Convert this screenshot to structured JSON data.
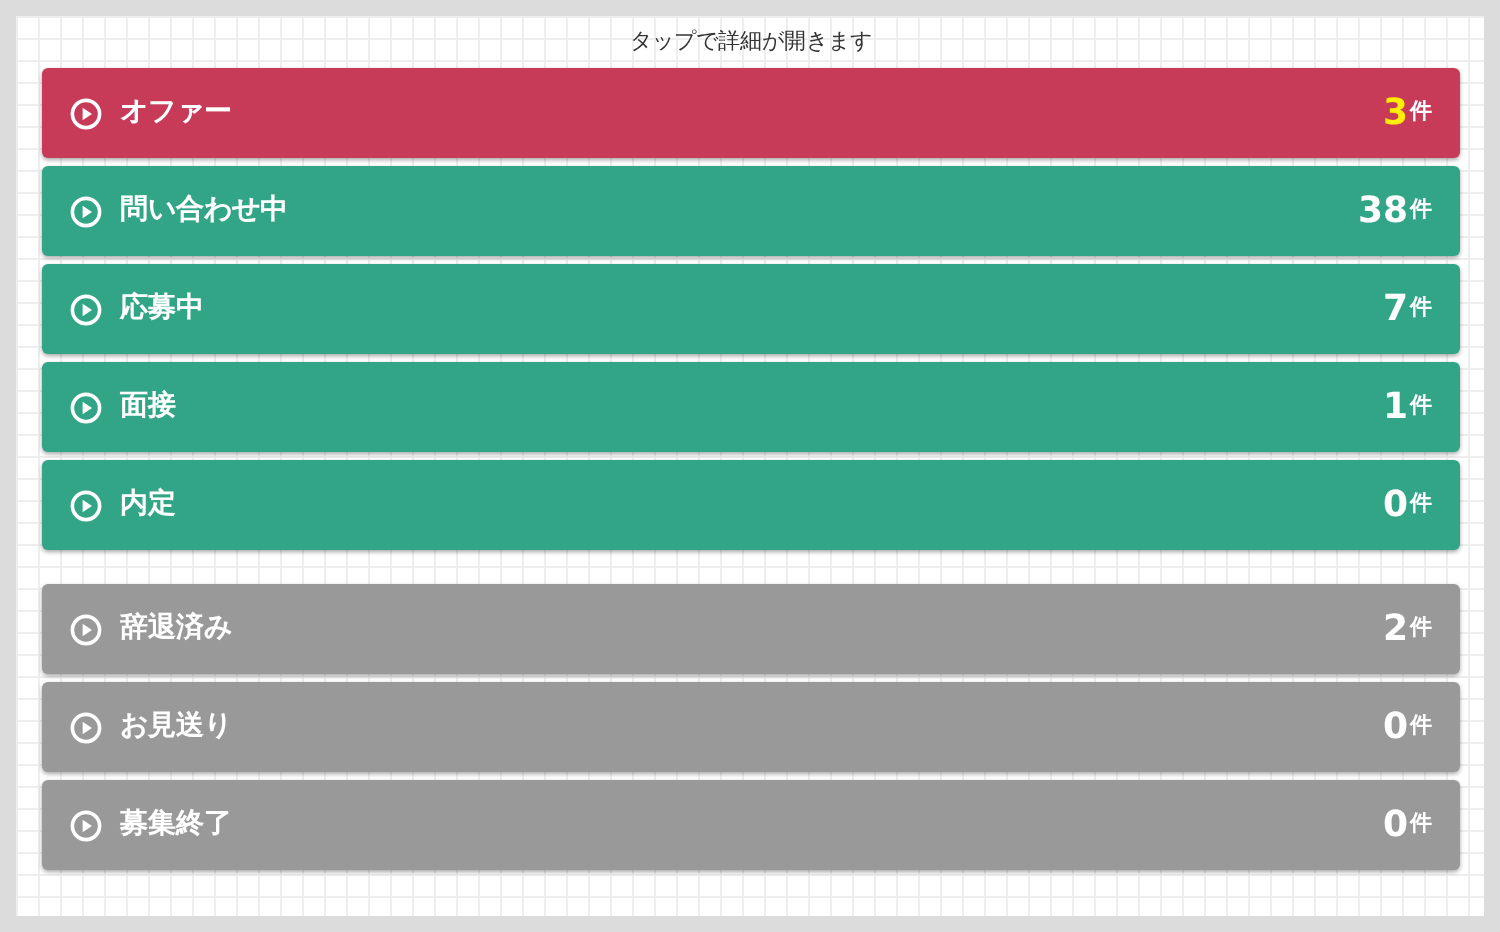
{
  "hint": "タップで詳細が開きます",
  "groups": [
    {
      "items": [
        {
          "kind": "offer",
          "label": "オファー",
          "count": "3",
          "unit": "件"
        },
        {
          "kind": "active",
          "label": "問い合わせ中",
          "count": "38",
          "unit": "件"
        },
        {
          "kind": "active",
          "label": "応募中",
          "count": "7",
          "unit": "件"
        },
        {
          "kind": "active",
          "label": "面接",
          "count": "1",
          "unit": "件"
        },
        {
          "kind": "active",
          "label": "内定",
          "count": "0",
          "unit": "件"
        }
      ]
    },
    {
      "items": [
        {
          "kind": "closed",
          "label": "辞退済み",
          "count": "2",
          "unit": "件"
        },
        {
          "kind": "closed",
          "label": "お見送り",
          "count": "0",
          "unit": "件"
        },
        {
          "kind": "closed",
          "label": "募集終了",
          "count": "0",
          "unit": "件"
        }
      ]
    }
  ]
}
